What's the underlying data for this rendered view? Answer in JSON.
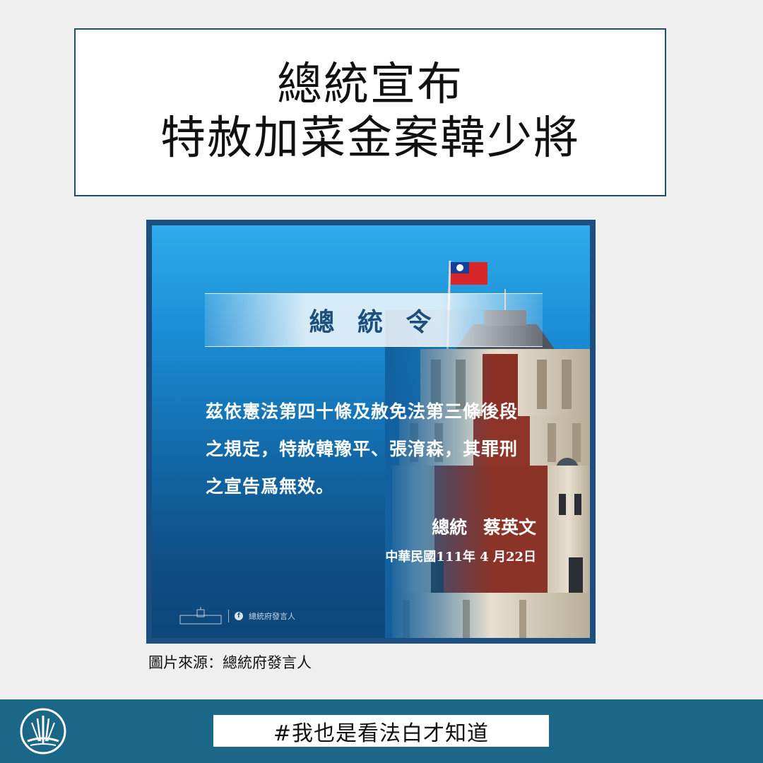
{
  "headline": {
    "line1": "總統宣布",
    "line2": "特赦加菜金案韓少將"
  },
  "image": {
    "banner_title": "總 統 令",
    "decree_lines": [
      "茲依憲法第四十條及赦免法第三條後段",
      "之規定，特赦韓豫平、張淯森，其罪刑",
      "之宣告爲無效。"
    ],
    "signature_title": "總統",
    "signature_name": "蔡英文",
    "date": "中華民國111年 4 月22日",
    "watermark_page": "總統府發言人",
    "watermark_icon": "facebook-icon"
  },
  "caption": "圖片來源：總統府發言人",
  "footer": {
    "hashtag": "#我也是看法白才知道",
    "logo_icon": "balance-logo-icon"
  },
  "colors": {
    "page_background": "#efefef",
    "headline_border": "#1f4f66",
    "footer_background": "#1b6787",
    "image_frame": "#1d4e82",
    "banner_text": "#1d4f7d"
  }
}
